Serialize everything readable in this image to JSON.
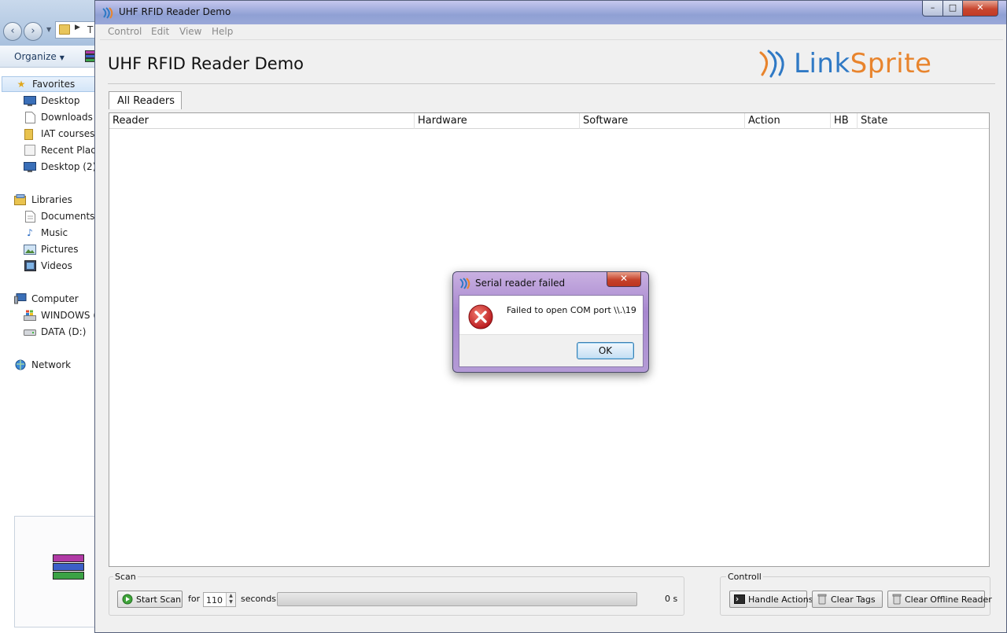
{
  "explorer": {
    "address_fragment": "T",
    "organize_label": "Organize",
    "favorites": [
      "Favorites",
      "Desktop",
      "Downloads",
      "IAT courses",
      "Recent Places",
      "Desktop (2)"
    ],
    "libraries": [
      "Libraries",
      "Documents",
      "Music",
      "Pictures",
      "Videos"
    ],
    "computer": [
      "Computer",
      "WINDOWS (C:)",
      "DATA (D:)"
    ],
    "network": "Network"
  },
  "window": {
    "title": "UHF RFID Reader Demo",
    "minimize": "–",
    "maximize": "□",
    "close": "✕"
  },
  "menu": [
    "Control",
    "Edit",
    "View",
    "Help"
  ],
  "app": {
    "heading": "UHF RFID Reader Demo",
    "logo_link": "Link",
    "logo_sprite": "Sprite"
  },
  "tabs": [
    "All Readers"
  ],
  "grid": {
    "columns": [
      "Reader",
      "Hardware",
      "Software",
      "Action",
      "HB",
      "State"
    ],
    "rows": []
  },
  "scan": {
    "group_label": "Scan",
    "start_label": "Start Scan",
    "for_label": "for",
    "duration": "110",
    "seconds_label": "seconds",
    "progress": 0,
    "elapsed": "0 s"
  },
  "control": {
    "group_label": "Controll",
    "handle_actions": "Handle Actions",
    "clear_tags": "Clear Tags",
    "clear_offline": "Clear Offline Reader"
  },
  "dialog": {
    "title": "Serial reader failed",
    "message": "Failed to open COM port \\\\.\\19",
    "ok_label": "OK",
    "close": "✕"
  },
  "colors": {
    "logo_blue": "#2f79c5",
    "logo_orange": "#e8842d",
    "error_red": "#c8201e"
  }
}
